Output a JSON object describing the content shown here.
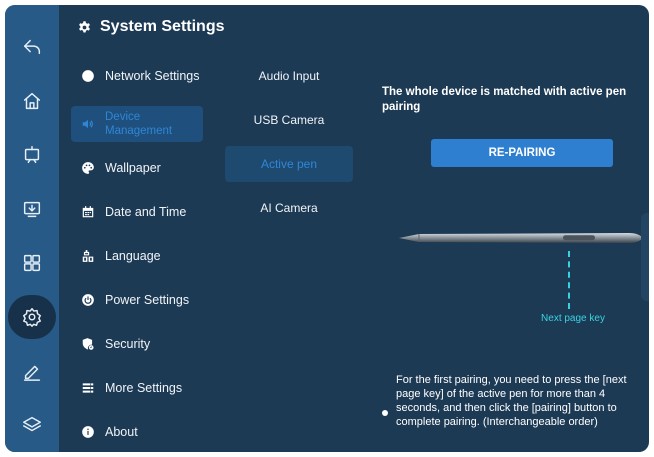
{
  "header": {
    "title": "System Settings",
    "icon": "gear-icon"
  },
  "rail": [
    {
      "name": "back",
      "icon": "back-icon"
    },
    {
      "name": "home",
      "icon": "home-icon"
    },
    {
      "name": "whiteboard",
      "icon": "whiteboard-icon"
    },
    {
      "name": "screen",
      "icon": "screen-download-icon"
    },
    {
      "name": "apps",
      "icon": "apps-grid-icon"
    },
    {
      "name": "settings",
      "icon": "settings-icon",
      "active": true
    },
    {
      "name": "annotate",
      "icon": "pen-icon"
    },
    {
      "name": "layers",
      "icon": "layers-icon"
    }
  ],
  "menu": {
    "items": [
      {
        "label": "Network Settings",
        "icon": "globe-icon"
      },
      {
        "label": "Device Management",
        "icon": "speaker-icon",
        "selected": true
      },
      {
        "label": "Wallpaper",
        "icon": "palette-icon"
      },
      {
        "label": "Date and Time",
        "icon": "calendar-icon"
      },
      {
        "label": "Language",
        "icon": "language-icon"
      },
      {
        "label": "Power Settings",
        "icon": "power-icon"
      },
      {
        "label": "Security",
        "icon": "security-icon"
      },
      {
        "label": "More Settings",
        "icon": "list-icon"
      },
      {
        "label": "About",
        "icon": "info-icon"
      }
    ]
  },
  "submenu": {
    "items": [
      {
        "label": "Audio Input"
      },
      {
        "label": "USB Camera"
      },
      {
        "label": "Active pen",
        "selected": true
      },
      {
        "label": "AI Camera"
      }
    ]
  },
  "panel": {
    "title": "The whole device is matched with active pen pairing",
    "button_label": "RE-PAIRING",
    "key_label": "Next page key",
    "note": "For the first pairing, you need to press the [next page key] of the active pen for more than 4 seconds, and then click the [pairing] button to complete pairing. (Interchangeable order)"
  },
  "colors": {
    "background": "#1d3a55",
    "rail": "#275a86",
    "accent": "#2f86d6",
    "button": "#2f7fd1",
    "key_marker": "#39d3e0"
  }
}
